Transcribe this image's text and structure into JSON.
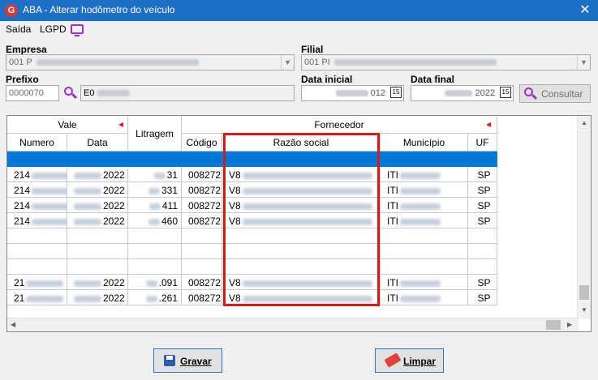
{
  "window": {
    "title": "ABA - Alterar hodômetro do veículo",
    "close_glyph": "✕"
  },
  "menu": {
    "items": [
      "Saída",
      "LGPD"
    ]
  },
  "form": {
    "empresa_label": "Empresa",
    "empresa_value": "001 P",
    "filial_label": "Filial",
    "filial_value": "001 PI",
    "prefixo_label": "Prefixo",
    "prefixo_value": "0000070",
    "prefixo_desc": "E0",
    "data_inicial_label": "Data inicial",
    "data_inicial_value": "012",
    "data_final_label": "Data final",
    "data_final_value": "2022",
    "consultar_label": "Consultar",
    "calendar_glyph": "15"
  },
  "grid": {
    "group_headers": {
      "vale": "Vale",
      "fornecedor": "Fornecedor"
    },
    "columns": {
      "numero": "Numero",
      "data": "Data",
      "litragem": "Litragem",
      "codigo": "Código",
      "razao_social": "Razão social",
      "municipio": "Município",
      "uf": "UF"
    },
    "rows": [
      {
        "numero": "",
        "data": "",
        "litragem": "",
        "codigo": "",
        "razao": "",
        "mun": "",
        "uf": "",
        "selected": true
      },
      {
        "numero": "214",
        "data": "2022",
        "litragem": "31",
        "codigo": "008272",
        "razao": "V8",
        "mun": "ITI",
        "uf": "SP"
      },
      {
        "numero": "214",
        "data": "2022",
        "litragem": "331",
        "codigo": "008272",
        "razao": "V8",
        "mun": "ITI",
        "uf": "SP"
      },
      {
        "numero": "214",
        "data": "2022",
        "litragem": "411",
        "codigo": "008272",
        "razao": "V8",
        "mun": "ITI",
        "uf": "SP"
      },
      {
        "numero": "214",
        "data": "2022",
        "litragem": "460",
        "codigo": "008272",
        "razao": "V8",
        "mun": "ITI",
        "uf": "SP"
      },
      {
        "numero": "",
        "data": "",
        "litragem": "",
        "codigo": "",
        "razao": "",
        "mun": "",
        "uf": ""
      },
      {
        "numero": "",
        "data": "",
        "litragem": "",
        "codigo": "",
        "razao": "",
        "mun": "",
        "uf": ""
      },
      {
        "numero": "",
        "data": "",
        "litragem": "",
        "codigo": "",
        "razao": "",
        "mun": "",
        "uf": ""
      },
      {
        "numero": "21",
        "data": "2022",
        "litragem": ".091",
        "codigo": "008272",
        "razao": "V8",
        "mun": "ITI",
        "uf": "SP"
      },
      {
        "numero": "21",
        "data": "2022",
        "litragem": ".261",
        "codigo": "008272",
        "razao": "V8",
        "mun": "ITI",
        "uf": "SP"
      }
    ]
  },
  "buttons": {
    "gravar": "Gravar",
    "limpar": "Limpar"
  },
  "colors": {
    "titlebar": "#1e6fc8",
    "selection": "#0078d7",
    "accent": "#9b32c8",
    "highlight_box": "#d61a1a"
  }
}
